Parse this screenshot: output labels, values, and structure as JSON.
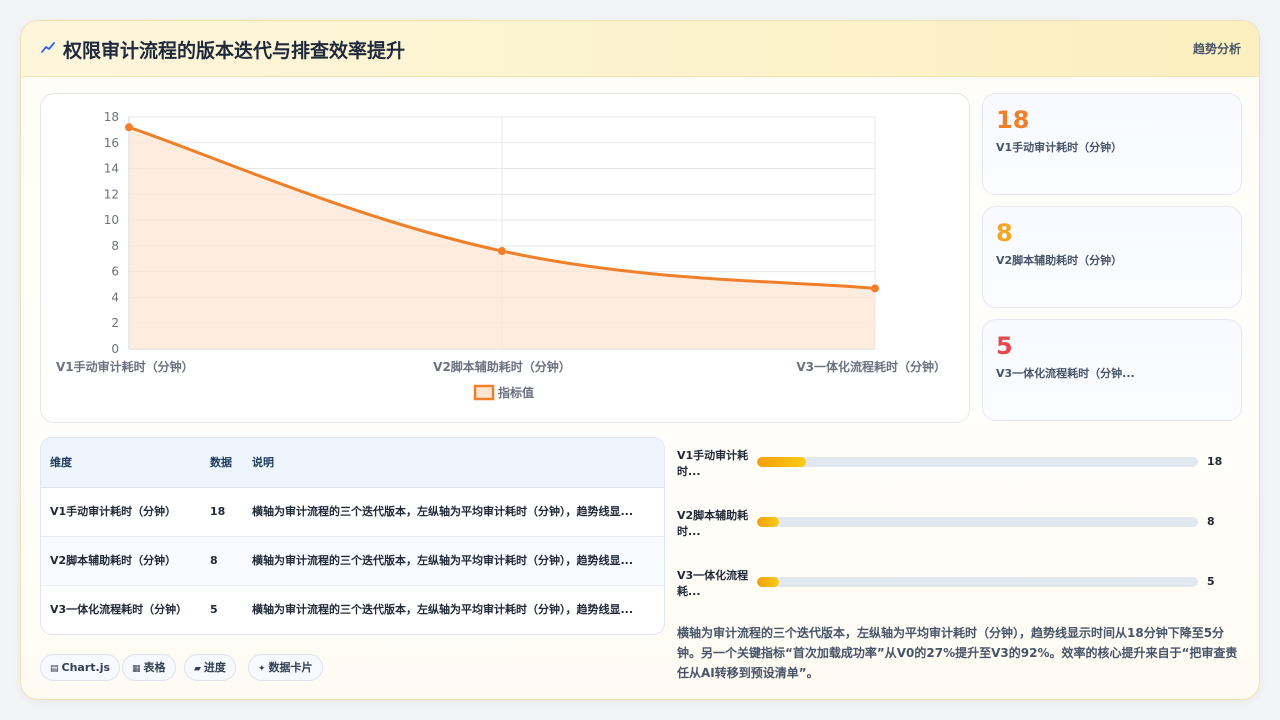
{
  "header": {
    "icon": "trend-icon",
    "title": "权限审计流程的版本迭代与排查效率提升",
    "tag": "趋势分析"
  },
  "colors": {
    "line": "#f07f2a",
    "area": "#fde5d4",
    "kpi_1": "#f07f2a",
    "kpi_2": "#f5a524",
    "kpi_3": "#e5484d"
  },
  "chart_data": {
    "type": "line",
    "categories": [
      "V1手动审计耗时（分钟）",
      "V2脚本辅助耗时（分钟）",
      "V3一体化流程耗时（分钟）"
    ],
    "series": [
      {
        "name": "指标值",
        "values": [
          17.2,
          7.6,
          4.7
        ]
      }
    ],
    "ylim": [
      0,
      18
    ],
    "yticks": [
      0,
      2,
      4,
      6,
      8,
      10,
      12,
      14,
      16,
      18
    ],
    "grid": true,
    "legend": "bottom",
    "area_fill": true
  },
  "kpis": [
    {
      "value": "18",
      "label": "V1手动审计耗时（分钟）"
    },
    {
      "value": "8",
      "label": "V2脚本辅助耗时（分钟）"
    },
    {
      "value": "5",
      "label": "V3一体化流程耗时（分钟..."
    }
  ],
  "table": {
    "headers": [
      "维度",
      "数据",
      "说明"
    ],
    "rows": [
      {
        "dim": "V1手动审计耗时（分钟）",
        "value": "18",
        "desc": "横轴为审计流程的三个迭代版本，左纵轴为平均审计耗时（分钟），趋势线显..."
      },
      {
        "dim": "V2脚本辅助耗时（分钟）",
        "value": "8",
        "desc": "横轴为审计流程的三个迭代版本，左纵轴为平均审计耗时（分钟），趋势线显..."
      },
      {
        "dim": "V3一体化流程耗时（分钟）",
        "value": "5",
        "desc": "横轴为审计流程的三个迭代版本，左纵轴为平均审计耗时（分钟），趋势线显..."
      }
    ]
  },
  "chips": [
    {
      "icon": "chart-icon",
      "glyph": "▤",
      "label": "Chart.js"
    },
    {
      "icon": "table-icon",
      "glyph": "▦",
      "label": "表格"
    },
    {
      "icon": "progress-icon",
      "glyph": "▰",
      "label": "进度"
    },
    {
      "icon": "sparkle-icon",
      "glyph": "✦",
      "label": "数据卡片"
    }
  ],
  "bars": [
    {
      "label": "V1手动审计耗时...",
      "value": "18",
      "fraction": 0.11
    },
    {
      "label": "V2脚本辅助耗时...",
      "value": "8",
      "fraction": 0.05
    },
    {
      "label": "V3一体化流程耗...",
      "value": "5",
      "fraction": 0.05
    }
  ],
  "summary": "横轴为审计流程的三个迭代版本，左纵轴为平均审计耗时（分钟），趋势线显示时间从18分钟下降至5分钟。另一个关键指标“首次加载成功率”从V0的27%提升至V3的92%。效率的核心提升来自于“把审查责任从AI转移到预设清单”。"
}
